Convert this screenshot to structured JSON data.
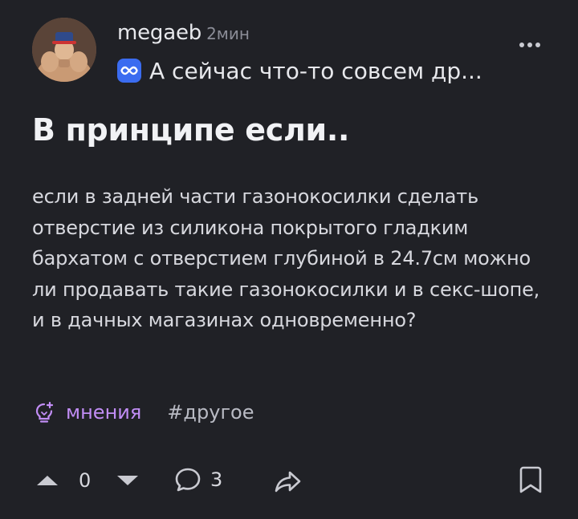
{
  "author": {
    "name": "megaeb",
    "time": "2мин"
  },
  "community": {
    "name": "А сейчас что-то совсем др...",
    "badge_icon": "infinity-icon",
    "badge_color": "#3b6cf0"
  },
  "post": {
    "title": "В принципе если..",
    "body": "если в задней части газонокосилки сделать отверстие из силикона покрытого гладким бархатом с отверстием глубиной в 24.7см можно ли продавать такие газонокосилки и в секс-шопе, и в дачных магазинах одновременно?",
    "tags": {
      "opinion": "мнения",
      "opinion_icon": "lightbulb-icon",
      "hashtag": "#другое"
    }
  },
  "actions": {
    "upvote_icon": "arrow-up-icon",
    "votes": "0",
    "downvote_icon": "arrow-down-icon",
    "comment_icon": "comment-icon",
    "comments": "3",
    "share_icon": "share-icon",
    "bookmark_icon": "bookmark-icon"
  },
  "colors": {
    "background": "#202126",
    "accent_purple": "#c18df5",
    "text_primary": "#e7e8ec",
    "text_muted": "#8b8d97"
  }
}
